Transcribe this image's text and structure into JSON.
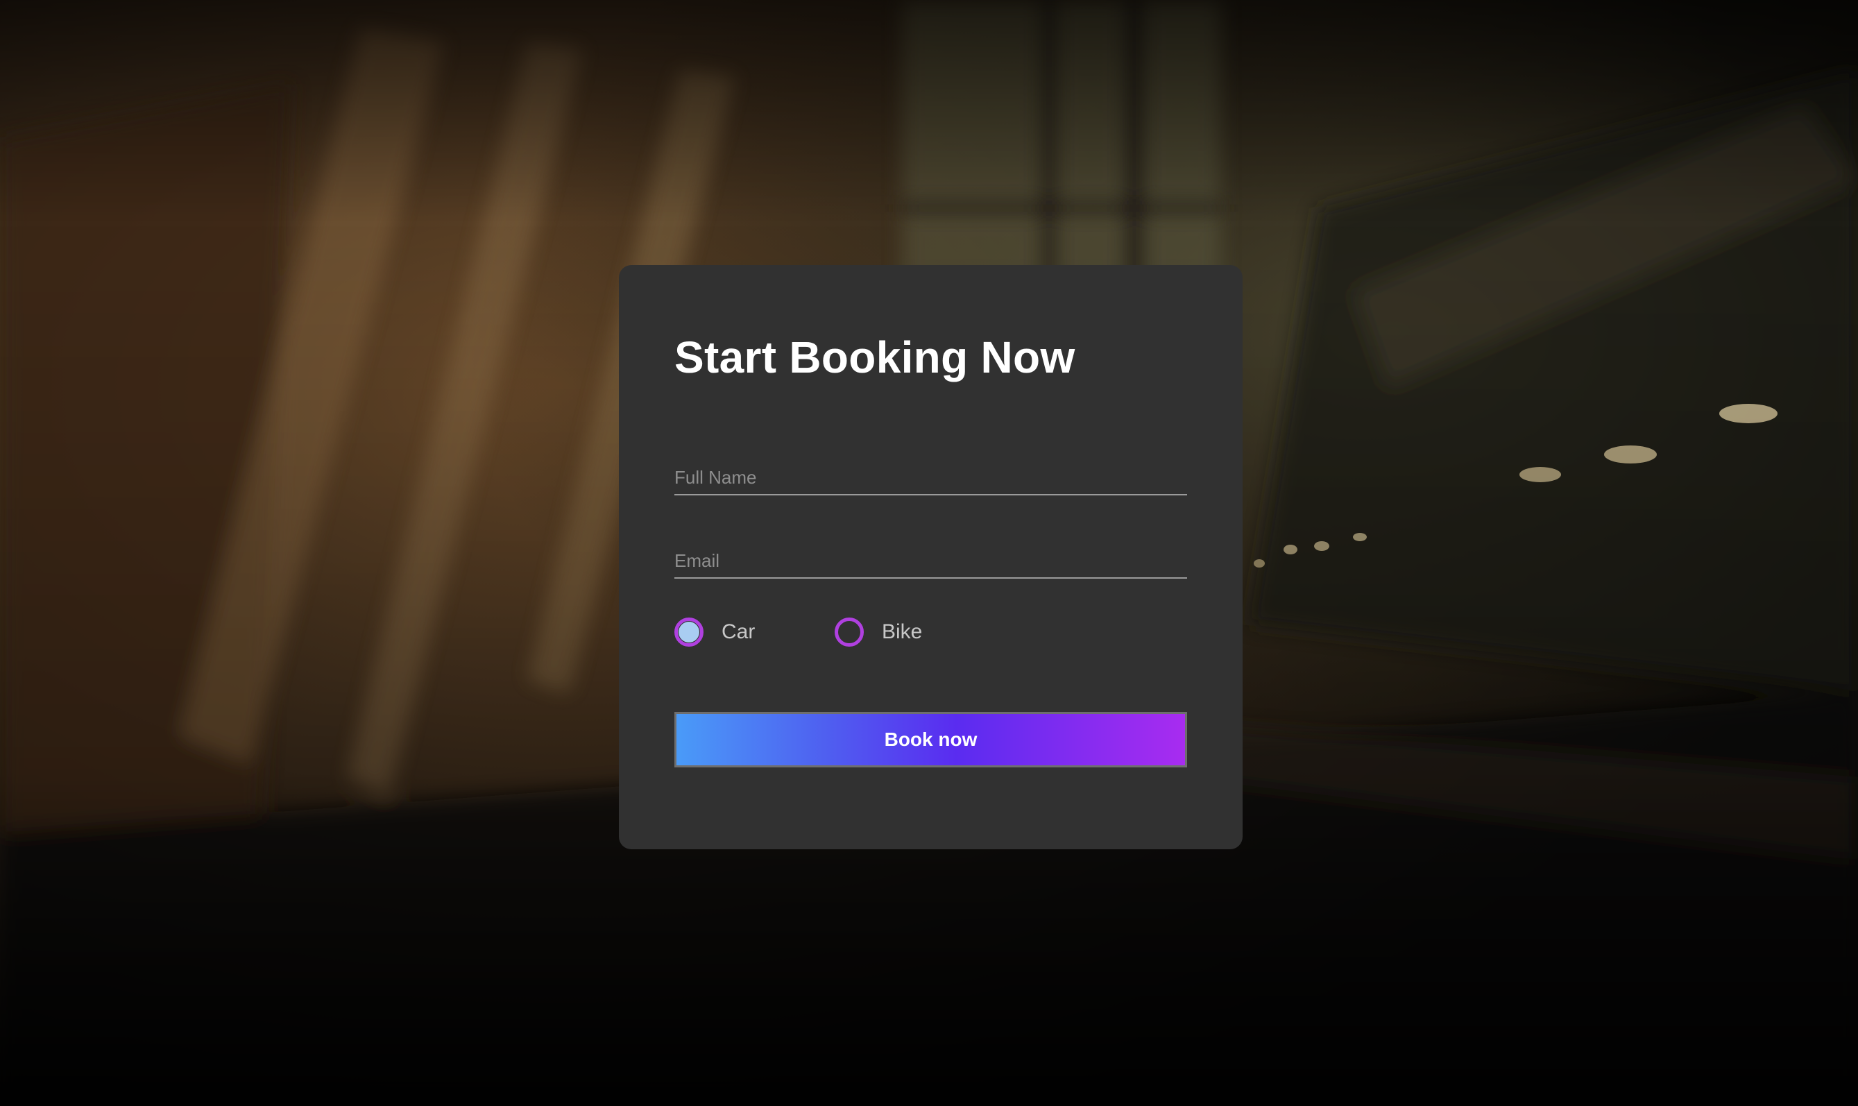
{
  "form": {
    "title": "Start Booking Now",
    "full_name": {
      "value": "",
      "placeholder": "Full Name"
    },
    "email": {
      "value": "",
      "placeholder": "Email"
    },
    "vehicle_options": [
      {
        "label": "Car",
        "selected": true
      },
      {
        "label": "Bike",
        "selected": false
      }
    ],
    "submit_label": "Book now"
  },
  "colors": {
    "card": "#313131",
    "radio_border": "#b040e0",
    "radio_fill": "#a9cdf2",
    "button_gradient_start": "#4a9bf8",
    "button_gradient_end": "#a82cf0"
  }
}
